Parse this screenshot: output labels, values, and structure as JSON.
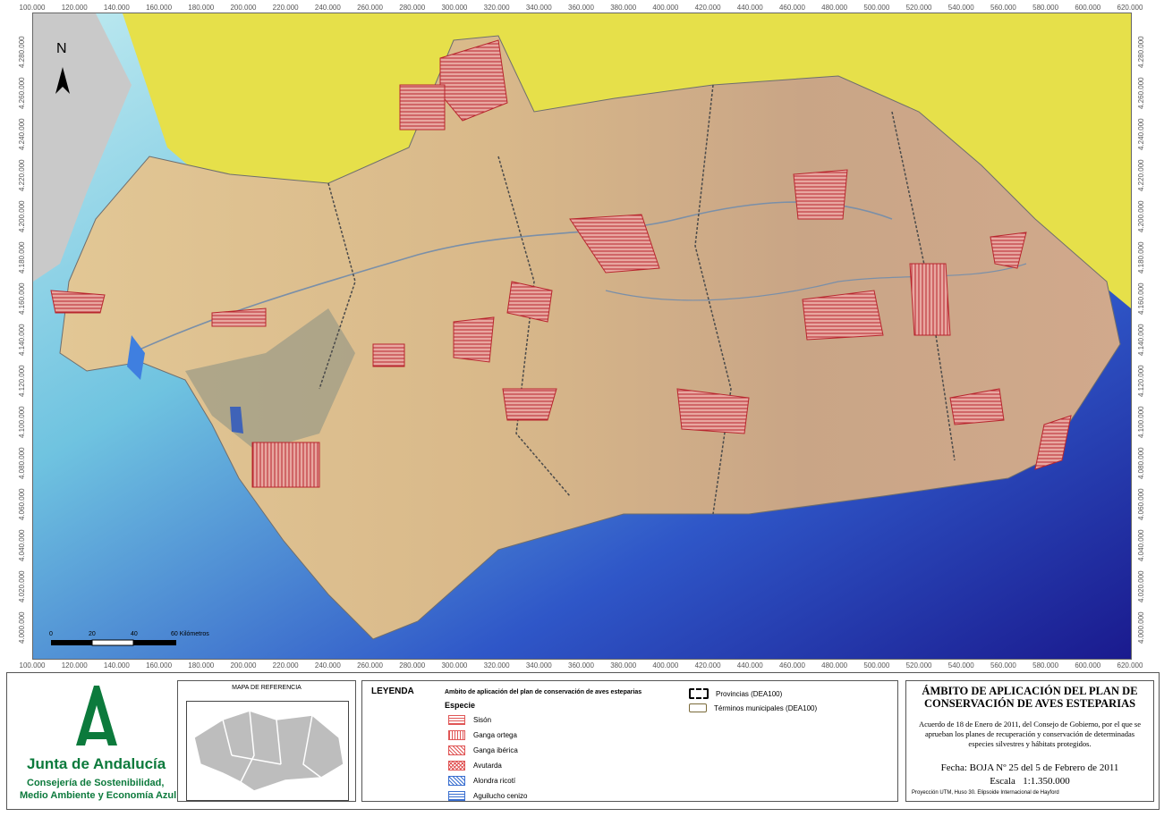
{
  "map": {
    "x_ticks": [
      "100.000",
      "120.000",
      "140.000",
      "160.000",
      "180.000",
      "200.000",
      "220.000",
      "240.000",
      "260.000",
      "280.000",
      "300.000",
      "320.000",
      "340.000",
      "360.000",
      "380.000",
      "400.000",
      "420.000",
      "440.000",
      "460.000",
      "480.000",
      "500.000",
      "520.000",
      "540.000",
      "560.000",
      "580.000",
      "600.000",
      "620.000"
    ],
    "y_ticks": [
      "4.280.000",
      "4.260.000",
      "4.240.000",
      "4.220.000",
      "4.200.000",
      "4.180.000",
      "4.160.000",
      "4.140.000",
      "4.120.000",
      "4.100.000",
      "4.080.000",
      "4.060.000",
      "4.040.000",
      "4.020.000",
      "4.000.000"
    ],
    "north_label": "N",
    "scale_labels": [
      "0",
      "20",
      "40",
      "60 Kilómetros"
    ],
    "colors": {
      "land": "#d9b88a",
      "sea_light": "#a8dfea",
      "sea_dark": "#1a1f9a",
      "outside": "#e6e04a",
      "portugal": "#c8c8c8",
      "habitat": "#c9383e"
    }
  },
  "logo": {
    "name": "Junta de Andalucía",
    "line1": "Consejería de Sostenibilidad,",
    "line2": "Medio Ambiente y Economía Azul",
    "color": "#0c7a3c"
  },
  "reference": {
    "title": "MAPA DE REFERENCIA"
  },
  "legend": {
    "title": "LEYENDA",
    "subtitle": "Ambito de aplicación del plan de conservación de aves esteparias",
    "species_header": "Especie",
    "species": [
      {
        "label": "Sisón",
        "color": "#e05656",
        "pattern": "horiz"
      },
      {
        "label": "Ganga ortega",
        "color": "#e05656",
        "pattern": "vert"
      },
      {
        "label": "Ganga ibérica",
        "color": "#e05656",
        "pattern": "diag"
      },
      {
        "label": "Avutarda",
        "color": "#e05656",
        "pattern": "cross"
      },
      {
        "label": "Alondra ricotí",
        "color": "#3a6fd0",
        "pattern": "diag"
      },
      {
        "label": "Aguilucho cenizo",
        "color": "#3a6fd0",
        "pattern": "horiz"
      }
    ],
    "boundaries": [
      {
        "label": "Provincias (DEA100)",
        "style": "thick"
      },
      {
        "label": "Términos municipales (DEA100)",
        "style": "thin"
      }
    ]
  },
  "title_block": {
    "title": "ÁMBITO DE APLICACIÓN DEL PLAN DE CONSERVACIÓN DE AVES ESTEPARIAS",
    "description": "Acuerdo de 18 de Enero de 2011, del Consejo de Gobierno, por el que se aprueban los planes de recuperación y conservación de determinadas especies silvestres y hábitats protegidos.",
    "date": "Fecha: BOJA Nº 25 del 5 de Febrero de 2011",
    "scale": "Escala   1:1.350.000",
    "projection": "Proyección UTM, Huso 30. Elipsoide Internacional de Hayford"
  }
}
